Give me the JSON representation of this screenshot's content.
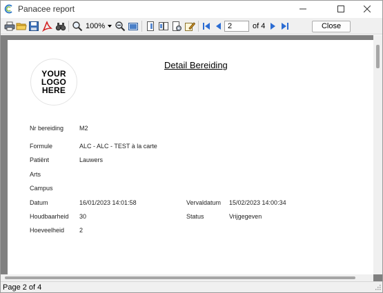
{
  "window": {
    "title": "Panacee report"
  },
  "toolbar": {
    "zoom_value": "100%",
    "page_current": "2",
    "page_of": "of 4",
    "close_label": "Close"
  },
  "report": {
    "logo_lines": [
      "YOUR",
      "LOGO",
      "HERE"
    ],
    "title": "Detail Bereiding",
    "fields": {
      "nr_label": "Nr bereiding",
      "nr_value": "M2",
      "formule_label": "Formule",
      "formule_value": "ALC - ALC - TEST  à la carte",
      "patient_label": "Patiënt",
      "patient_value": "Lauwers",
      "arts_label": "Arts",
      "campus_label": "Campus",
      "datum_label": "Datum",
      "datum_value": "16/01/2023 14:01:58",
      "vervaldatum_label": "Vervaldatum",
      "vervaldatum_value": "15/02/2023 14:00:34",
      "houdbaarheid_label": "Houdbaarheid",
      "houdbaarheid_value": "30",
      "status_label": "Status",
      "status_value": "Vrijgegeven",
      "hoeveelheid_label": "Hoeveelheid",
      "hoeveelheid_value": "2"
    }
  },
  "statusbar": {
    "text": "Page 2 of 4"
  },
  "colors": {
    "viewer_bg": "#808080",
    "toolbar_bg": "#f0f0f0",
    "nav_blue": "#2b6cd3"
  }
}
